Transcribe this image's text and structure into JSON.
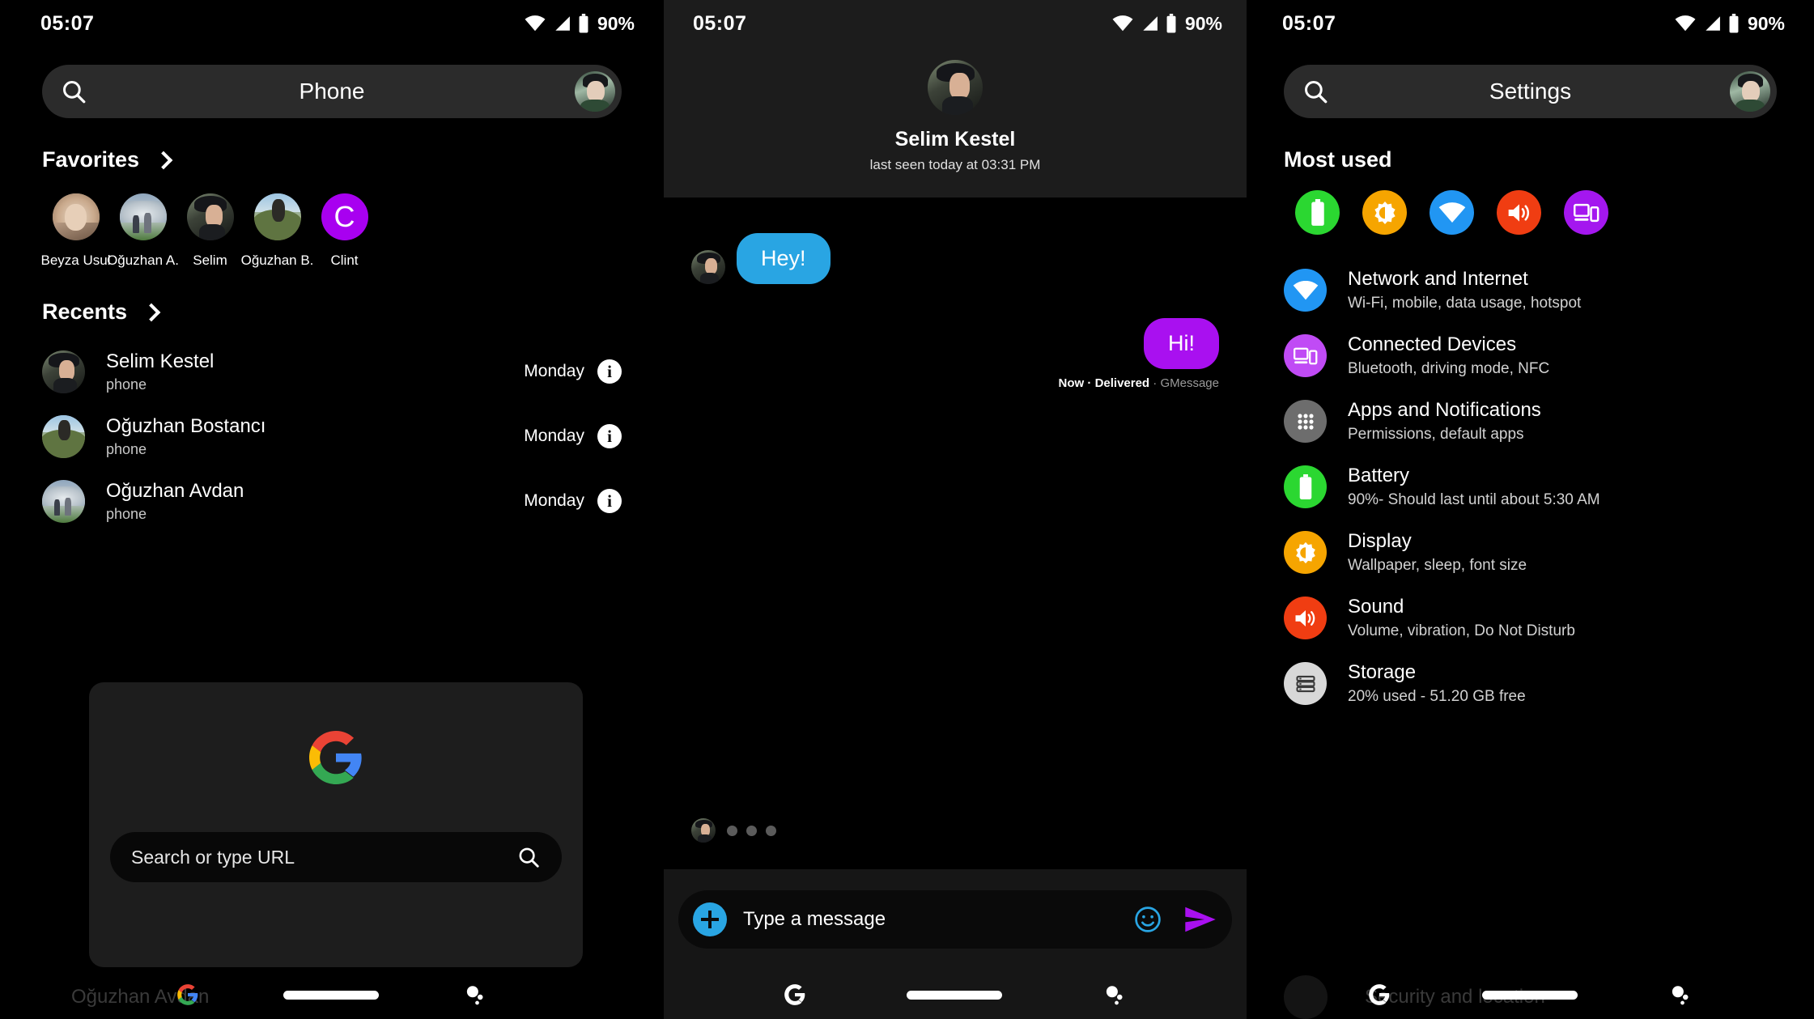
{
  "status": {
    "time": "05:07",
    "battery": "90%",
    "wifi_icon": "wifi-icon",
    "signal_icon": "cell-signal-icon",
    "battery_icon": "battery-icon"
  },
  "panel1": {
    "search": {
      "title": "Phone",
      "icon": "search-icon",
      "avatar": "profile-avatar"
    },
    "favorites": {
      "heading": "Favorites",
      "chevron": "chevron-right-icon",
      "items": [
        {
          "name": "Beyza Usul",
          "avatar": "photo"
        },
        {
          "name": "Oğuzhan A.",
          "avatar": "photo"
        },
        {
          "name": "Selim",
          "avatar": "photo"
        },
        {
          "name": "Oğuzhan B.",
          "avatar": "photo"
        },
        {
          "name": "Clint",
          "avatar": "initial",
          "initial": "C",
          "color": "#a800f0"
        }
      ]
    },
    "recents": {
      "heading": "Recents",
      "chevron": "chevron-right-icon",
      "items": [
        {
          "name": "Selim Kestel",
          "sub": "phone",
          "when": "Monday",
          "info": "i"
        },
        {
          "name": "Oğuzhan Bostancı",
          "sub": "phone",
          "when": "Monday",
          "info": "i"
        },
        {
          "name": "Oğuzhan Avdan",
          "sub": "phone",
          "when": "Monday",
          "info": "i"
        }
      ]
    },
    "chrome_card": {
      "logo": "google-g-logo",
      "url_placeholder": "Search or type URL",
      "search_icon": "search-icon"
    },
    "ghost_text": "Oğuzhan Avdan"
  },
  "panel2": {
    "contact": {
      "name": "Selim Kestel",
      "status": "last seen today at 03:31 PM",
      "avatar": "photo"
    },
    "messages": [
      {
        "dir": "in",
        "text": "Hey!",
        "color": "#29a5e3"
      },
      {
        "dir": "out",
        "text": "Hi!",
        "color": "#a910f0",
        "meta_time": "Now",
        "meta_sep1": " · ",
        "meta_status": "Delivered",
        "meta_sep2": " · ",
        "meta_app": "GMessage"
      }
    ],
    "typing_indicator": {
      "avatar": "photo",
      "dots": 3
    },
    "composer": {
      "plus_icon": "plus-icon",
      "placeholder": "Type a message",
      "emoji_icon": "emoji-smiley-icon",
      "send_icon": "send-icon"
    }
  },
  "panel3": {
    "search": {
      "title": "Settings",
      "icon": "search-icon",
      "avatar": "profile-avatar"
    },
    "most_used": {
      "heading": "Most used",
      "items": [
        {
          "name": "battery-icon",
          "color": "#2bd731"
        },
        {
          "name": "display-brightness-icon",
          "color": "#f6a500"
        },
        {
          "name": "wifi-icon",
          "color": "#2196f3"
        },
        {
          "name": "sound-volume-icon",
          "color": "#f03d12"
        },
        {
          "name": "connected-devices-icon",
          "color": "#a417ef"
        }
      ]
    },
    "settings": [
      {
        "title": "Network and Internet",
        "sub": "Wi-Fi, mobile, data usage, hotspot",
        "icon": "wifi-icon",
        "color": "#2196f3"
      },
      {
        "title": "Connected Devices",
        "sub": "Bluetooth, driving mode, NFC",
        "icon": "connected-devices-icon",
        "color": "#c04bf5"
      },
      {
        "title": "Apps and Notifications",
        "sub": "Permissions, default apps",
        "icon": "apps-grid-icon",
        "color": "#6d6d6d"
      },
      {
        "title": "Battery",
        "sub": "90%- Should last until about 5:30 AM",
        "icon": "battery-icon",
        "color": "#2bd731"
      },
      {
        "title": "Display",
        "sub": "Wallpaper, sleep, font size",
        "icon": "display-brightness-icon",
        "color": "#f6a500"
      },
      {
        "title": "Sound",
        "sub": "Volume, vibration, Do Not Disturb",
        "icon": "sound-volume-icon",
        "color": "#f03d12"
      },
      {
        "title": "Storage",
        "sub": "20% used - 51.20 GB free",
        "icon": "storage-icon",
        "color": "#d8d8d8"
      }
    ],
    "ghost_text": "Security and location"
  },
  "navbar": {
    "google_icon": "google-g-icon",
    "home_pill": "home-gesture-pill",
    "assistant_icon": "assistant-icon"
  }
}
